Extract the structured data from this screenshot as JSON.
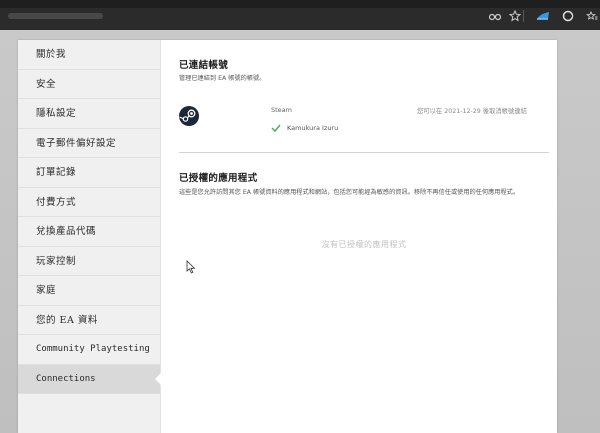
{
  "browser": {
    "icons": [
      "reader-mode-icon",
      "favorite-star-icon",
      "edge-collections-icon",
      "extension-icon",
      "favorites-bar-icon"
    ]
  },
  "sidebar": {
    "items": [
      {
        "label": "關於我",
        "active": false
      },
      {
        "label": "安全",
        "active": false
      },
      {
        "label": "隱私設定",
        "active": false
      },
      {
        "label": "電子郵件偏好設定",
        "active": false
      },
      {
        "label": "訂單記錄",
        "active": false
      },
      {
        "label": "付費方式",
        "active": false
      },
      {
        "label": "兌換產品代碼",
        "active": false
      },
      {
        "label": "玩家控制",
        "active": false
      },
      {
        "label": "家庭",
        "active": false
      },
      {
        "label": "您的 EA 資料",
        "active": false
      },
      {
        "label": "Community Playtesting",
        "active": false
      },
      {
        "label": "Connections",
        "active": true
      }
    ]
  },
  "linked_accounts": {
    "title": "已連結帳號",
    "description": "管理已連結到 EA 帳號的帳號。",
    "service": {
      "name": "Steam",
      "username": "Kamukura Izuru",
      "disconnect_note": "您可以在 2021-12-29 後取消帳號連結"
    }
  },
  "authorized_apps": {
    "title": "已授權的應用程式",
    "description": "這些是您允許訪問其您 EA 帳號資料的應用程式和網站，包括您可能經為敏感的資訊。移除不再信任或使用的任何應用程式。",
    "empty_message": "沒有已授權的應用程式"
  },
  "colors": {
    "background": "#b9b9b9",
    "card": "#ffffff",
    "sidebar": "#f0f0f0",
    "sidebar_active": "#d9d9d9",
    "check_green": "#4caf50",
    "steam_blue": "#1b2838"
  }
}
